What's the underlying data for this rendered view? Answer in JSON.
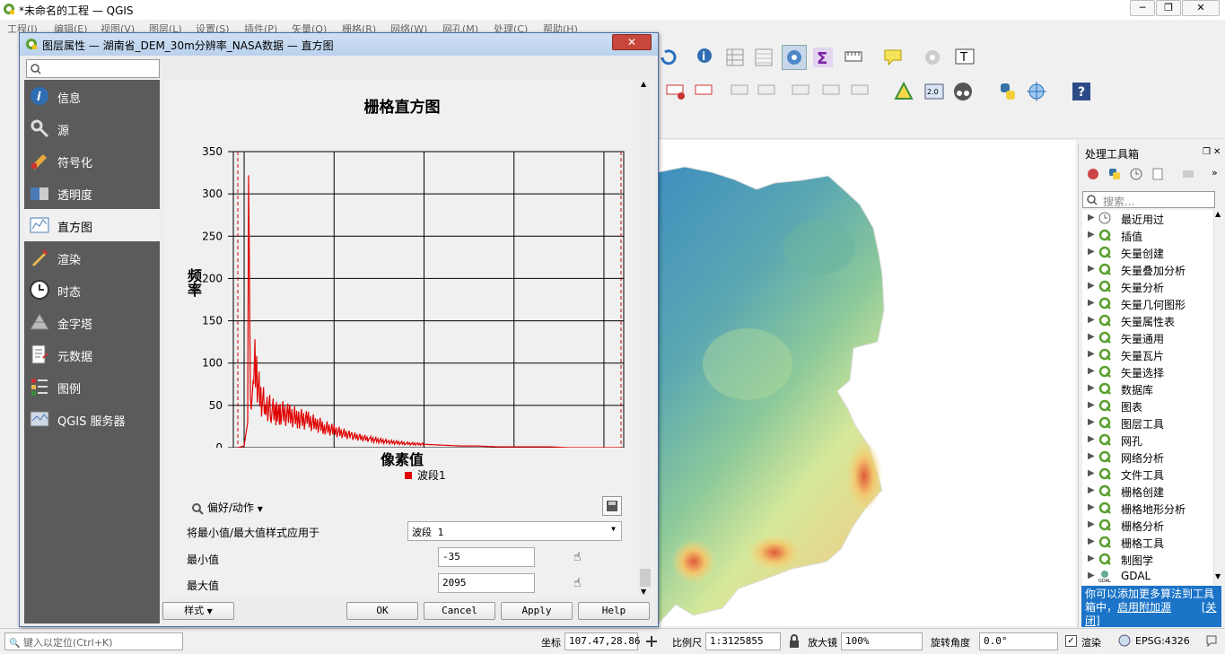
{
  "app": {
    "title": "*未命名的工程 — QGIS"
  },
  "menu": [
    "工程(J)",
    "编辑(E)",
    "视图(V)",
    "图层(L)",
    "设置(S)",
    "插件(P)",
    "矢量(O)",
    "栅格(R)",
    "网络(W)",
    "网孔(M)",
    "处理(C)",
    "帮助(H)"
  ],
  "dialog": {
    "title": "图层属性 — 湖南省_DEM_30m分辨率_NASA数据 — 直方图",
    "close_label": "✕",
    "nav": [
      {
        "label": "信息",
        "icon": "info-icon"
      },
      {
        "label": "源",
        "icon": "source-icon"
      },
      {
        "label": "符号化",
        "icon": "symbology-icon"
      },
      {
        "label": "透明度",
        "icon": "transparency-icon"
      },
      {
        "label": "直方图",
        "icon": "histogram-icon"
      },
      {
        "label": "渲染",
        "icon": "rendering-icon"
      },
      {
        "label": "时态",
        "icon": "temporal-icon"
      },
      {
        "label": "金字塔",
        "icon": "pyramids-icon"
      },
      {
        "label": "元数据",
        "icon": "metadata-icon"
      },
      {
        "label": "图例",
        "icon": "legend-icon"
      },
      {
        "label": "QGIS 服务器",
        "icon": "server-icon"
      }
    ],
    "active_nav": "直方图",
    "prefs_label": "偏好/动作",
    "apply_minmax_label": "将最小值/最大值样式应用于",
    "band_value": "波段 1",
    "min_label": "最小值",
    "min_value": "-35",
    "max_label": "最大值",
    "max_value": "2095",
    "style_label": "样式",
    "ok_label": "OK",
    "cancel_label": "Cancel",
    "apply_label": "Apply",
    "help_label": "Help"
  },
  "chart_data": {
    "type": "line",
    "title": "栅格直方图",
    "xlabel": "像素值",
    "ylabel": "频率",
    "xlim": [
      -60,
      2110
    ],
    "ylim": [
      0,
      350
    ],
    "xticks": [
      0,
      500,
      1000,
      1500,
      2000
    ],
    "yticks": [
      0,
      50,
      100,
      150,
      200,
      250,
      300,
      350
    ],
    "grid": true,
    "legend_position": "bottom",
    "min_marker": -35,
    "max_marker": 2095,
    "series": [
      {
        "name": "波段1",
        "color": "#e00000",
        "x": [
          -35,
          0,
          20,
          25,
          30,
          35,
          40,
          50,
          60,
          70,
          80,
          90,
          100,
          120,
          150,
          180,
          200,
          250,
          300,
          350,
          400,
          450,
          500,
          600,
          700,
          800,
          900,
          1000,
          1100,
          1200,
          1300,
          1400,
          1500,
          1600,
          1700,
          1800,
          1900,
          2000,
          2095
        ],
        "y": [
          0,
          2,
          30,
          322,
          200,
          60,
          45,
          80,
          95,
          88,
          70,
          60,
          55,
          50,
          45,
          40,
          42,
          38,
          35,
          32,
          28,
          24,
          20,
          14,
          10,
          7,
          5,
          4,
          3,
          2,
          2,
          1,
          1,
          1,
          1,
          0,
          0,
          0,
          0
        ]
      }
    ]
  },
  "toolbox": {
    "title": "处理工具箱",
    "search_placeholder": "搜索...",
    "items": [
      "最近用过",
      "插值",
      "矢量创建",
      "矢量叠加分析",
      "矢量分析",
      "矢量几何图形",
      "矢量属性表",
      "矢量通用",
      "矢量瓦片",
      "矢量选择",
      "数据库",
      "图表",
      "图层工具",
      "网孔",
      "网络分析",
      "文件工具",
      "栅格创建",
      "栅格地形分析",
      "栅格分析",
      "栅格工具",
      "制图学",
      "GDAL"
    ],
    "info_text": "你可以添加更多算法到工具箱中，",
    "info_link": "启用附加源",
    "info_close": "[关闭]"
  },
  "statusbar": {
    "locate_placeholder": "键入以定位(Ctrl+K)",
    "coord_label": "坐标",
    "coord_value": "107.47,28.86",
    "scale_label": "比例尺",
    "scale_value": "1:3125855",
    "magnifier_label": "放大镜",
    "magnifier_value": "100%",
    "rotation_label": "旋转角度",
    "rotation_value": "0.0°",
    "render_label": "渲染",
    "crs_label": "EPSG:4326"
  }
}
